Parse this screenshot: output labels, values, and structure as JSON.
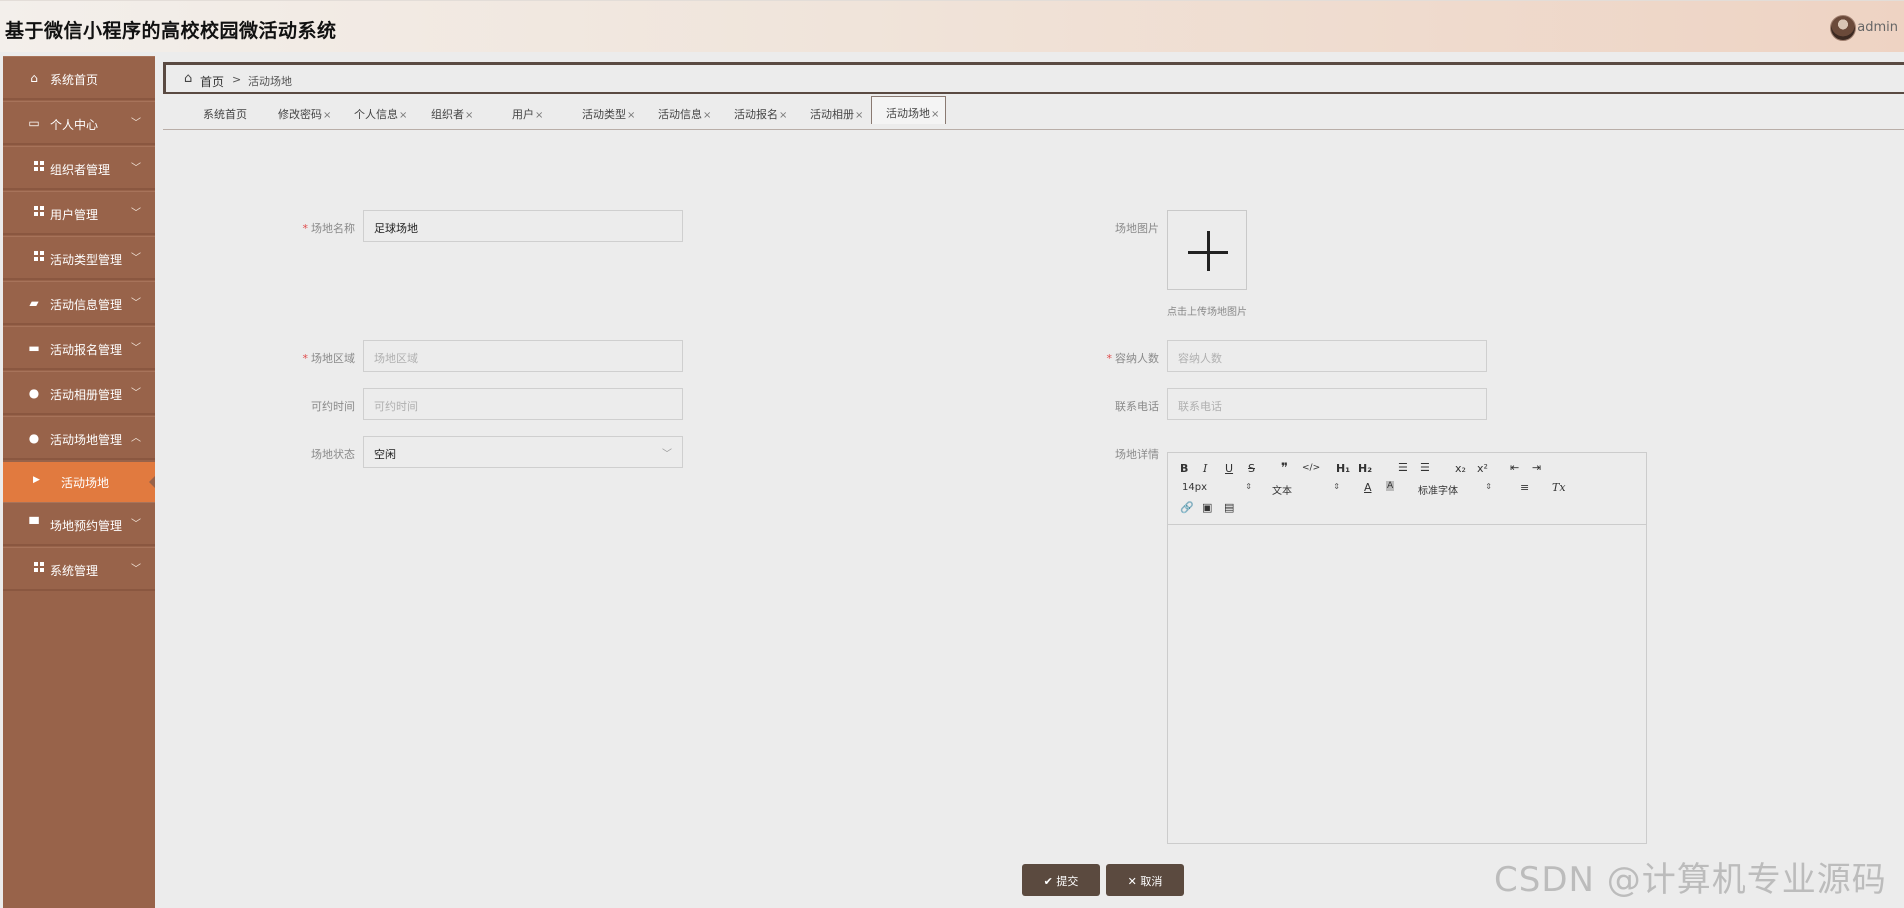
{
  "header": {
    "title": "基于微信小程序的高校校园微活动系统",
    "username": "admin"
  },
  "sidebar": {
    "items": [
      {
        "label": "系统首页",
        "icon": "home-icon",
        "arrow": ""
      },
      {
        "label": "个人中心",
        "icon": "id-card-icon",
        "arrow": "﹀"
      },
      {
        "label": "组织者管理",
        "icon": "grid-icon",
        "arrow": "﹀"
      },
      {
        "label": "用户管理",
        "icon": "grid-icon",
        "arrow": "﹀"
      },
      {
        "label": "活动类型管理",
        "icon": "grid-icon",
        "arrow": "﹀"
      },
      {
        "label": "活动信息管理",
        "icon": "chat-icon",
        "arrow": "﹀"
      },
      {
        "label": "活动报名管理",
        "icon": "briefcase-icon",
        "arrow": "﹀"
      },
      {
        "label": "活动相册管理",
        "icon": "user-icon",
        "arrow": "﹀"
      },
      {
        "label": "活动场地管理",
        "icon": "location-pin-icon",
        "arrow": "︿"
      },
      {
        "label": "场地预约管理",
        "icon": "chair-icon",
        "arrow": "﹀"
      },
      {
        "label": "系统管理",
        "icon": "grid-icon",
        "arrow": "﹀"
      }
    ],
    "sub_item": {
      "label": "活动场地"
    }
  },
  "breadcrumb": {
    "home": "首页",
    "separator": ">",
    "current": "活动场地"
  },
  "tabs": [
    {
      "label": "系统首页",
      "close": ""
    },
    {
      "label": "修改密码",
      "close": "×"
    },
    {
      "label": "个人信息",
      "close": "×"
    },
    {
      "label": "组织者",
      "close": "×"
    },
    {
      "label": "用户",
      "close": "×"
    },
    {
      "label": "活动类型",
      "close": "×"
    },
    {
      "label": "活动信息",
      "close": "×"
    },
    {
      "label": "活动报名",
      "close": "×"
    },
    {
      "label": "活动相册",
      "close": "×"
    },
    {
      "label": "活动场地",
      "close": "×"
    }
  ],
  "form": {
    "name": {
      "label": "场地名称",
      "value": "足球场地"
    },
    "image": {
      "label": "场地图片",
      "tip": "点击上传场地图片"
    },
    "area": {
      "label": "场地区域",
      "placeholder": "场地区域"
    },
    "capacity": {
      "label": "容纳人数",
      "placeholder": "容纳人数"
    },
    "time": {
      "label": "可约时间",
      "placeholder": "可约时间"
    },
    "phone": {
      "label": "联系电话",
      "placeholder": "联系电话"
    },
    "status": {
      "label": "场地状态",
      "value": "空闲"
    },
    "detail": {
      "label": "场地详情"
    },
    "required_mark": "*"
  },
  "editor": {
    "font_size": "14px",
    "header": "文本",
    "font_family": "标准字体",
    "h1": "H₁",
    "h2": "H₂",
    "sub": "x₂",
    "sup": "x²",
    "bold": "B",
    "italic": "I",
    "underline": "U",
    "strike": "S",
    "quote": "❞",
    "code": "</>",
    "color": "A",
    "bg_color": "A",
    "clean": "Tx"
  },
  "buttons": {
    "submit": "提交",
    "cancel": "取消",
    "submit_icon": "✔",
    "cancel_icon": "✕"
  },
  "watermark": "CSDN @计算机专业源码",
  "colors": {
    "sidebar": "#98634a",
    "active_menu": "#e17a3f",
    "button": "#5b4a3f"
  }
}
